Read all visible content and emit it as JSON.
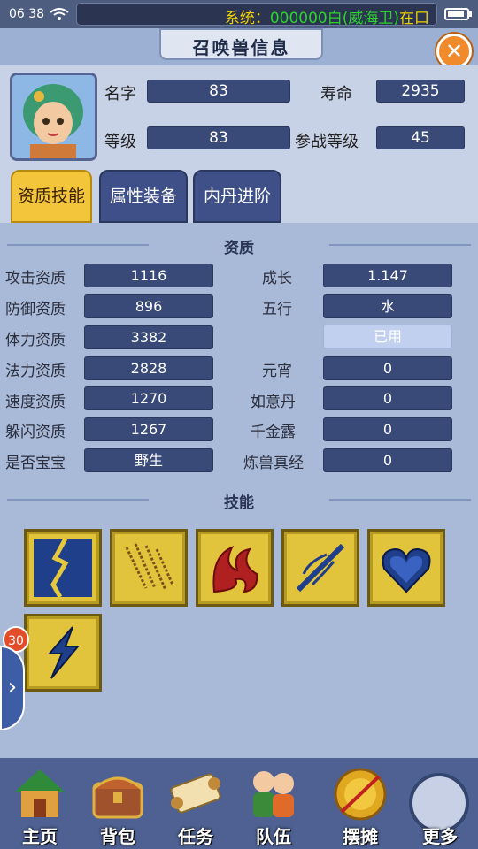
{
  "status": {
    "time": "06 38",
    "system_message_prefix": "系统：",
    "system_message_main": "000000白(威海卫)",
    "system_message_tail": "在口"
  },
  "title": "召唤兽信息",
  "pet": {
    "name_label": "名字",
    "name_value": "83",
    "life_label": "寿命",
    "life_value": "2935",
    "level_label": "等级",
    "level_value": "83",
    "battle_level_label": "参战等级",
    "battle_level_value": "45"
  },
  "tabs": [
    {
      "label": "资质技能"
    },
    {
      "label": "属性装备"
    },
    {
      "label": "内丹进阶"
    }
  ],
  "aptitude": {
    "heading": "资质",
    "rows_left": [
      {
        "label": "攻击资质",
        "value": "1116"
      },
      {
        "label": "防御资质",
        "value": "896"
      },
      {
        "label": "体力资质",
        "value": "3382"
      },
      {
        "label": "法力资质",
        "value": "2828"
      },
      {
        "label": "速度资质",
        "value": "1270"
      },
      {
        "label": "躲闪资质",
        "value": "1267"
      },
      {
        "label": "是否宝宝",
        "value": "野生"
      }
    ],
    "rows_right": [
      {
        "label": "成长",
        "value": "1.147"
      },
      {
        "label": "五行",
        "value": "水"
      },
      {
        "label": "",
        "value": "已用"
      },
      {
        "label": "元宵",
        "value": "0"
      },
      {
        "label": "如意丹",
        "value": "0"
      },
      {
        "label": "千金露",
        "value": "0"
      },
      {
        "label": "炼兽真经",
        "value": "0"
      }
    ]
  },
  "skills_heading": "技能",
  "skills": [
    {
      "icon": "lightning-crack-icon"
    },
    {
      "icon": "wind-lines-icon"
    },
    {
      "icon": "flame-swirl-icon"
    },
    {
      "icon": "spear-strike-icon"
    },
    {
      "icon": "heart-shield-icon"
    },
    {
      "icon": "lightning-bolt-icon"
    }
  ],
  "badge_count": "30",
  "bottom_nav": [
    {
      "label": "主页"
    },
    {
      "label": "背包"
    },
    {
      "label": "任务"
    },
    {
      "label": "队伍"
    },
    {
      "label": "摆摊"
    },
    {
      "label": "更多"
    }
  ],
  "colors": {
    "accent_orange": "#f08a2a",
    "field_blue": "#3a4a78",
    "tab_gold": "#f2c53a",
    "skill_gold": "#e2c43c",
    "system_green": "#2cd42c",
    "system_yellow": "#f0d000"
  }
}
